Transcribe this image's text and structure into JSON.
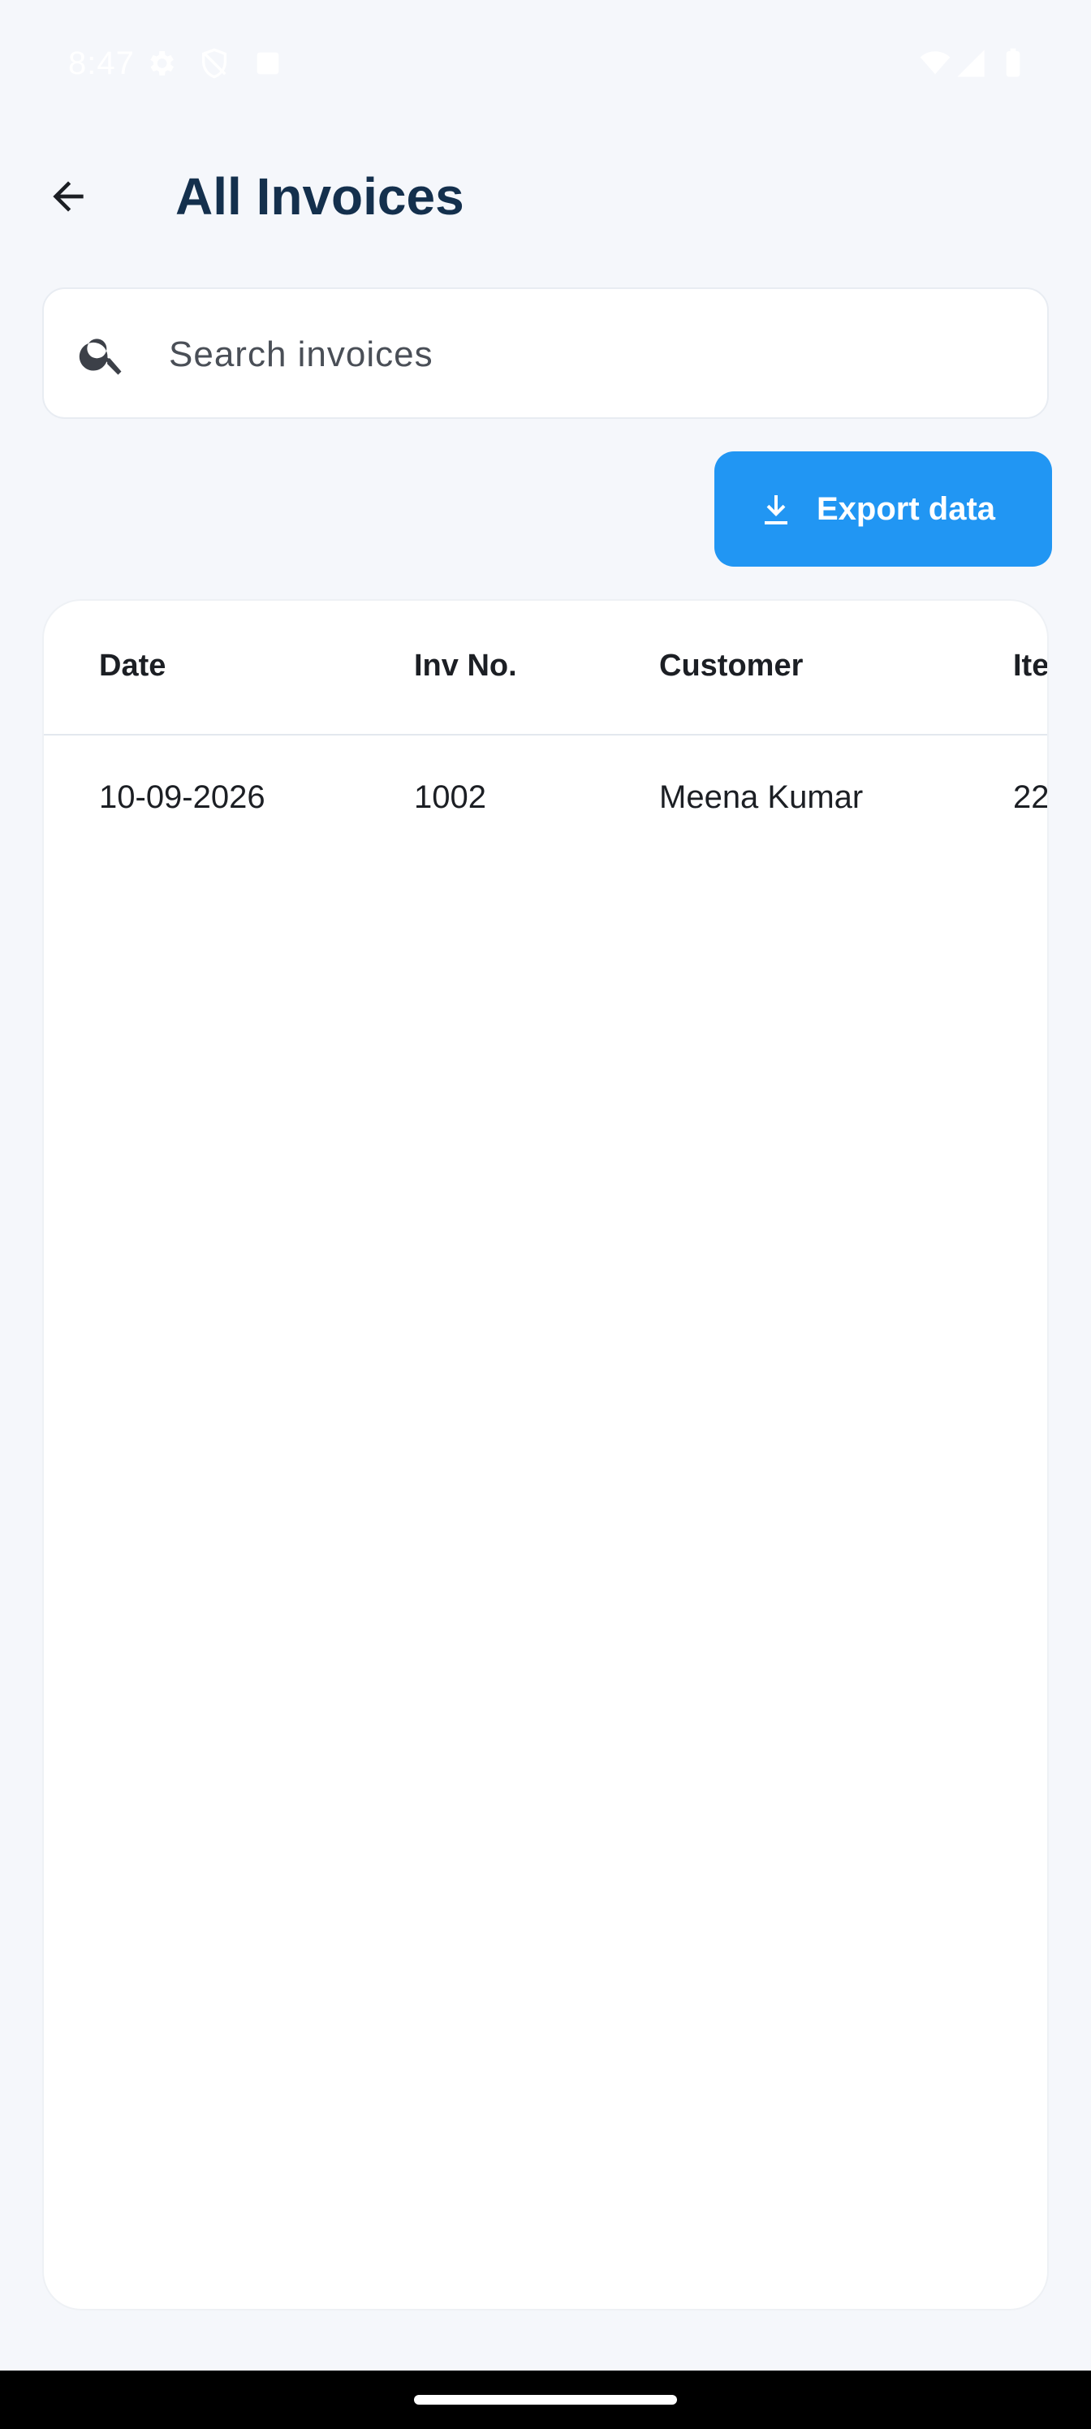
{
  "status_bar": {
    "time": "8:47",
    "icons": [
      "settings-icon",
      "shield-icon",
      "notification-icon",
      "wifi-icon",
      "signal-icon",
      "battery-icon"
    ]
  },
  "app_bar": {
    "title": "All Invoices",
    "back_icon": "arrow-back-icon"
  },
  "search": {
    "placeholder": "Search invoices",
    "value": "",
    "icon": "search-icon"
  },
  "export": {
    "label": "Export data",
    "icon": "download-icon",
    "color": "#2196f3"
  },
  "table": {
    "headers": [
      "Date",
      "Inv No.",
      "Customer",
      "Ite"
    ],
    "rows": [
      [
        "10-09-2026",
        "1002",
        "Meena Kumar",
        "22"
      ]
    ]
  },
  "colors": {
    "title": "#14304d",
    "background": "#f5f7fb",
    "card": "#ffffff"
  }
}
